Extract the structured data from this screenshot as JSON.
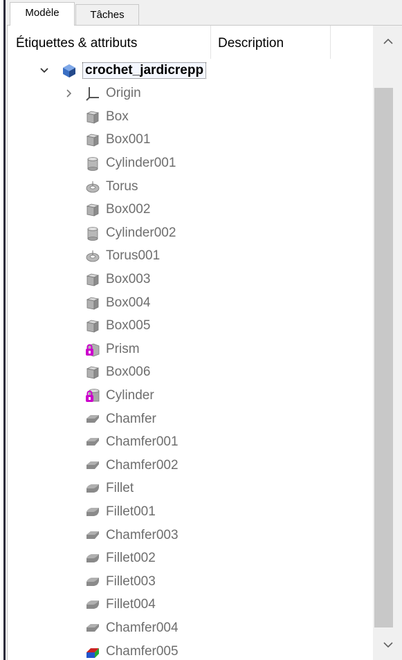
{
  "tabs": [
    {
      "label": "Modèle",
      "active": true
    },
    {
      "label": "Tâches",
      "active": false
    }
  ],
  "columns": {
    "labels": "Étiquettes & attributs",
    "description": "Description"
  },
  "tree": {
    "root": {
      "label": "crochet_jardicrepp",
      "icon": "part-document-icon",
      "expanded": true
    },
    "items": [
      {
        "label": "Origin",
        "icon": "origin-axes-icon",
        "expandable": true
      },
      {
        "label": "Box",
        "icon": "box-icon"
      },
      {
        "label": "Box001",
        "icon": "box-icon"
      },
      {
        "label": "Cylinder001",
        "icon": "cylinder-icon"
      },
      {
        "label": "Torus",
        "icon": "torus-icon"
      },
      {
        "label": "Box002",
        "icon": "box-icon"
      },
      {
        "label": "Cylinder002",
        "icon": "cylinder-icon"
      },
      {
        "label": "Torus001",
        "icon": "torus-icon"
      },
      {
        "label": "Box003",
        "icon": "box-icon"
      },
      {
        "label": "Box004",
        "icon": "box-icon"
      },
      {
        "label": "Box005",
        "icon": "box-icon"
      },
      {
        "label": "Prism",
        "icon": "prism-locked-icon"
      },
      {
        "label": "Box006",
        "icon": "box-icon"
      },
      {
        "label": "Cylinder",
        "icon": "cylinder-locked-icon"
      },
      {
        "label": "Chamfer",
        "icon": "chamfer-icon"
      },
      {
        "label": "Chamfer001",
        "icon": "chamfer-icon"
      },
      {
        "label": "Chamfer002",
        "icon": "chamfer-icon"
      },
      {
        "label": "Fillet",
        "icon": "fillet-icon"
      },
      {
        "label": "Fillet001",
        "icon": "fillet-icon"
      },
      {
        "label": "Chamfer003",
        "icon": "chamfer-icon"
      },
      {
        "label": "Fillet002",
        "icon": "fillet-icon"
      },
      {
        "label": "Fillet003",
        "icon": "fillet-icon"
      },
      {
        "label": "Fillet004",
        "icon": "fillet-icon"
      },
      {
        "label": "Chamfer004",
        "icon": "chamfer-icon"
      },
      {
        "label": "Chamfer005",
        "icon": "chamfer-active-icon"
      }
    ]
  },
  "colors": {
    "lock": "#cc00cc",
    "active_red": "#cc2222",
    "active_green": "#22aa33",
    "active_blue": "#2255cc"
  }
}
